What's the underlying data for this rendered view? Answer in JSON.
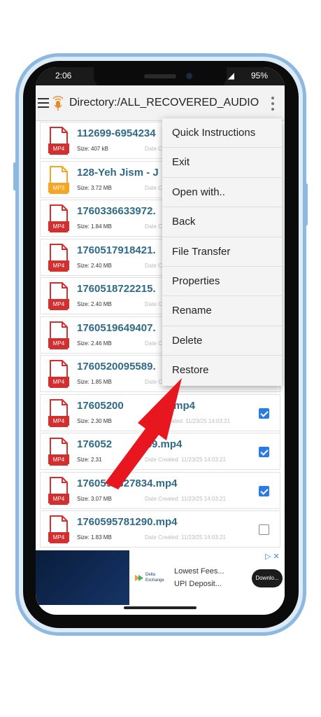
{
  "status_bar": {
    "time": "2:06",
    "signal": "◢",
    "battery": "95%"
  },
  "toolbar": {
    "title": "Directory:/ALL_RECOVERED_AUDIO"
  },
  "files": [
    {
      "name": "112699-6954234",
      "size": "Size: 407 kB",
      "date": "Date C",
      "type": "MP4",
      "checked": null
    },
    {
      "name": "128-Yeh Jism - J",
      "size": "Size: 3.72 MB",
      "date": "Date C",
      "type": "MP3",
      "checked": null
    },
    {
      "name": "1760336633972.",
      "size": "Size: 1.84 MB",
      "date": "Date C",
      "type": "MP4",
      "checked": null
    },
    {
      "name": "1760517918421.",
      "size": "Size: 2.40 MB",
      "date": "Date C",
      "type": "MP4",
      "checked": null
    },
    {
      "name": "1760518722215.",
      "size": "Size: 2.40 MB",
      "date": "Date C",
      "type": "MP4",
      "checked": null
    },
    {
      "name": "1760519649407.",
      "size": "Size: 2.46 MB",
      "date": "Date C",
      "type": "MP4",
      "checked": null
    },
    {
      "name": "1760520095589.",
      "size": "Size: 1.85 MB",
      "date": "Date C",
      "type": "MP4",
      "checked": null
    },
    {
      "name": "17605200",
      "size": "Size: 2.30 MB",
      "date": "reated: 11/23/25 14:03:21",
      "type": "MP4",
      "checked": true
    },
    {
      "name": "176052",
      "size": "Size: 2.31",
      "date": "Date Created: 11/23/25 14:03:21",
      "type": "MP4",
      "checked": true
    },
    {
      "name": "1760595327834.mp4",
      "size": "Size: 3.07 MB",
      "date": "Date Created: 11/23/25 14:03:21",
      "type": "MP4",
      "checked": true
    },
    {
      "name": "1760595781290.mp4",
      "size": "Size: 1.83 MB",
      "date": "Date Created: 11/23/25 14:03:21",
      "type": "MP4",
      "checked": false
    }
  ],
  "file_name_tails": {
    "row7": ".mp4",
    "row8": "4149.mp4"
  },
  "menu": [
    {
      "label": "Quick Instructions",
      "name": "menu-quick-instructions"
    },
    {
      "label": "Exit",
      "name": "menu-exit"
    },
    {
      "label": "Open with..",
      "name": "menu-open-with"
    },
    {
      "label": "Back",
      "name": "menu-back"
    },
    {
      "label": "File Transfer",
      "name": "menu-file-transfer"
    },
    {
      "label": "Properties",
      "name": "menu-properties"
    },
    {
      "label": "Rename",
      "name": "menu-rename"
    },
    {
      "label": "Delete",
      "name": "menu-delete"
    },
    {
      "label": "Restore",
      "name": "menu-restore"
    }
  ],
  "ad": {
    "logo_text": "Delta Exchange",
    "line1": "Lowest Fees...",
    "line2": "UPI Deposit...",
    "button": "Downlo...",
    "icons": "▷ ✕"
  },
  "colors": {
    "mp4": "#d32f2f",
    "mp3": "#f5a623",
    "file_name": "#2f6a86",
    "arrow": "#e8161f",
    "checkbox": "#2a7be4"
  },
  "icons": {
    "menu": "hamburger-icon",
    "app": "microphone-icon",
    "overflow": "kebab-icon",
    "annotation": "red-arrow"
  }
}
